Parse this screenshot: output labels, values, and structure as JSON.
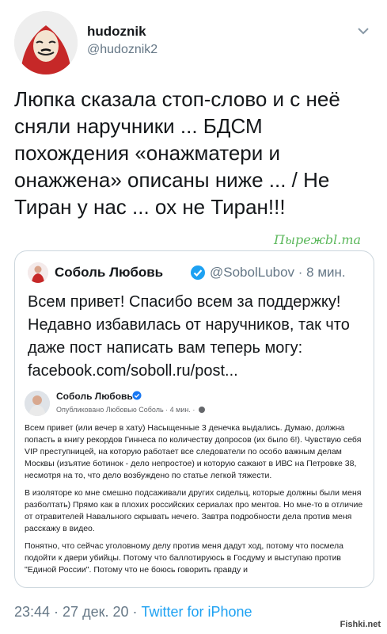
{
  "tweet": {
    "display_name": "hudoznik",
    "handle": "@hudoznik2",
    "text": "Люпка сказала стоп-слово и с неё сняли наручники ... БДСМ похождения «онажматери и онажжена» описаны ниже ... / Не Тиран у нас ... ох не Тиран!!!",
    "footer_time": "23:44 · 27 дек. 20 · ",
    "footer_source": "Twitter for iPhone"
  },
  "watermark": "Пырежbl.ma",
  "quote": {
    "name": "Соболь Любовь",
    "handle": "@SobolLubov · 8 мин.",
    "text": "Всем привет! Спасибо всем за поддержку! Недавно избавилась от наручников, так что даже пост написать вам теперь могу: facebook.com/soboll.ru/post..."
  },
  "fb_post": {
    "name": "Соболь Любовь",
    "meta": "Опубликовано Любовью Соболь · 4 мин. ·",
    "paragraphs": [
      "Всем привет (или вечер в хату) Насыщенные 3 денечка выдались. Думаю, должна попасть в книгу рекордов Гиннеса по количеству допросов (их было 6!). Чувствую себя VIP преступницей, на которую работает все следователи по особо важным делам Москвы (изъятие ботинок - дело непростое) и которую сажают в ИВС на Петровке 38, несмотря на то, что дело возбуждено по статье легкой тяжести.",
      "В изоляторе ко мне смешно подсаживали других сидельц, которые должны были меня разболтать) Прямо как в плохих российских сериалах про ментов. Но мне-то в отличие от отравителей Навального скрывать нечего. Завтра подробности дела против меня расскажу в видео.",
      "Понятно, что сейчас уголовному делу против меня дадут ход, потому что посмела подойти к двери убийцы. Потому что баллотируюсь в Госдуму и выступаю против \"Единой России\". Потому что не боюсь говорить правду и"
    ]
  },
  "site_logo": "Fishki.net",
  "colors": {
    "link": "#1da1f2",
    "secondary_text": "#657786",
    "verified": "#1da1f2",
    "avatar_mask": "#b71c1c"
  },
  "icons": [
    "chevron-down-icon",
    "verified-badge-icon",
    "globe-icon"
  ]
}
